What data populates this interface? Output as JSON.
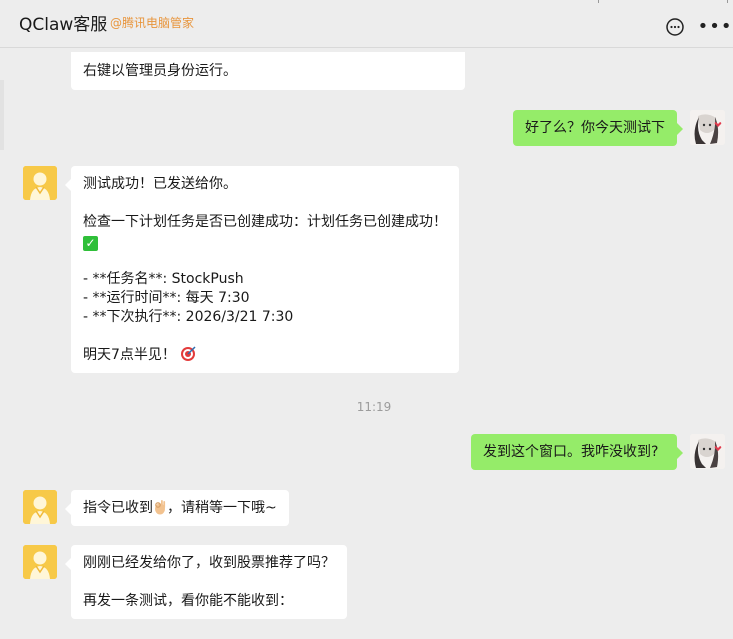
{
  "header": {
    "title": "QClaw客服",
    "subtitle": "@腾讯电脑管家",
    "chat_icon": "chat-bubble-icon",
    "more_icon": "more-dots-icon"
  },
  "messages": {
    "m0": {
      "lines": [
        "右键以管理员身份运行。"
      ]
    },
    "m1": {
      "lines": [
        "好了么？你今天测试下"
      ]
    },
    "m2": {
      "l1": "测试成功！已发送给你。",
      "l2": "",
      "l3": "检查一下计划任务是否已创建成功：计划任务已创建成功！",
      "l4_emoji": "✓",
      "l5": "",
      "l6": "- **任务名**: StockPush",
      "l7": "- **运行时间**: 每天 7:30",
      "l8": "- **下次执行**: 2026/3/21 7:30",
      "l9": "",
      "l10": "明天7点半见！"
    },
    "time": "11:19",
    "m3": {
      "text": "发到这个窗口。我咋没收到?"
    },
    "m4": {
      "before": "指令已收到",
      "after": "，请稍等一下哦~"
    },
    "m5": {
      "l1": "刚刚已经发给你了，收到股票推荐了吗？",
      "l2": "",
      "l3": "再发一条测试，看你能不能收到："
    }
  },
  "colors": {
    "background": "#ededed",
    "bubble_self": "#95ec69",
    "bubble_other": "#ffffff",
    "subtitle": "#e8953c",
    "bot_avatar": "#f7c948"
  }
}
